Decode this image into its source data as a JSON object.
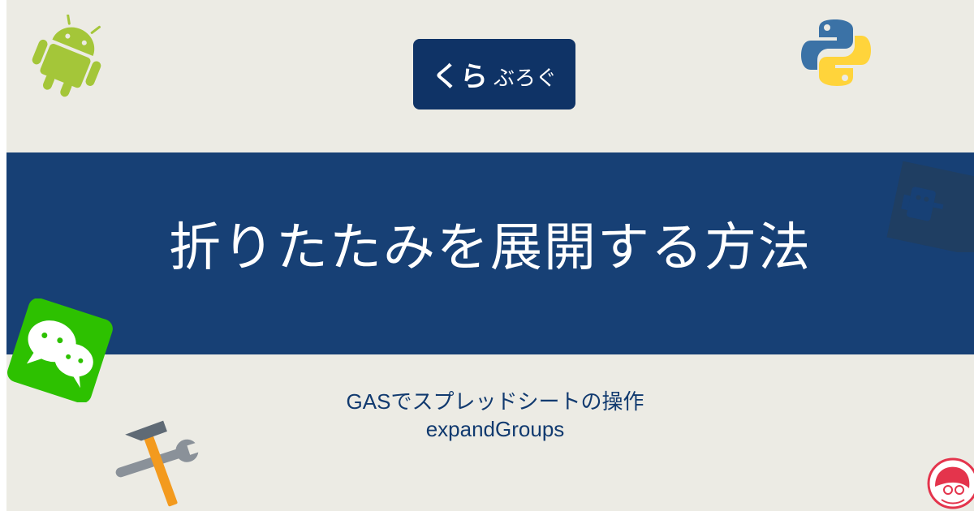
{
  "brand": {
    "logo_main": "くら",
    "logo_sub": "ぶろぐ"
  },
  "banner": {
    "title": "折りたたみを展開する方法"
  },
  "subtitle": {
    "line1": "GASでスプレッドシートの操作",
    "line2": "expandGroups"
  },
  "colors": {
    "background": "#ecebe4",
    "banner": "#174075",
    "logo_box": "#0f3366",
    "subtitle_text": "#113a6f",
    "android_green": "#a4c639",
    "python_blue": "#3b72a6",
    "python_yellow": "#ffd43b",
    "wechat_green": "#2dc100",
    "tool_orange": "#f39a1e",
    "tool_gray": "#8a9199",
    "avatar_red": "#e4344c"
  },
  "icons": [
    "android-icon",
    "python-icon",
    "robot-icon",
    "chat-icon",
    "tools-icon",
    "avatar-icon"
  ]
}
